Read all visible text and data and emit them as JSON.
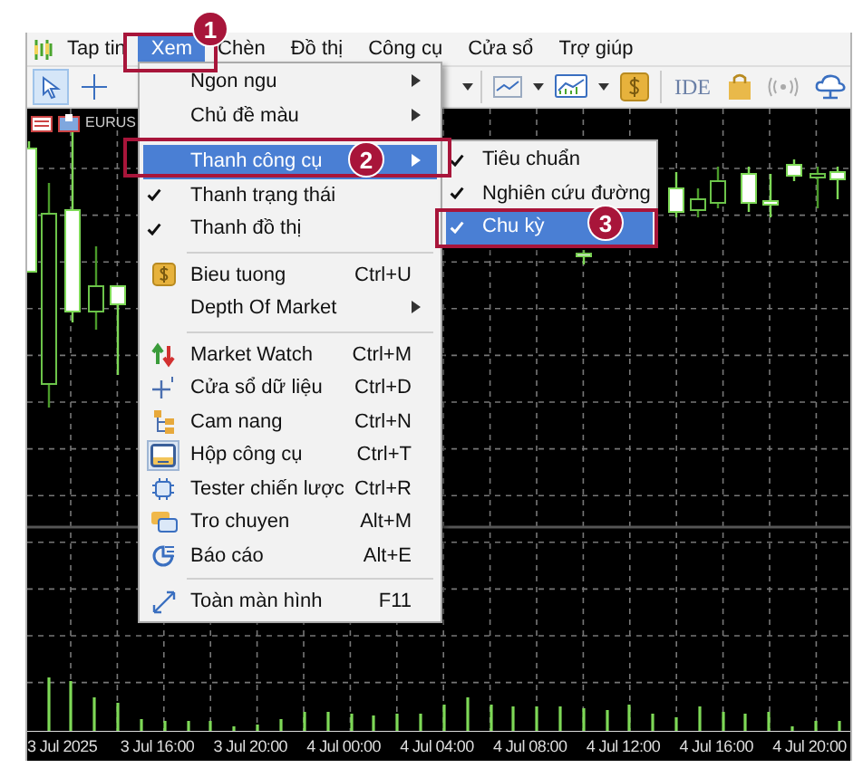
{
  "menubar": [
    {
      "label": "Tap tin",
      "selected": false
    },
    {
      "label": "Xem",
      "selected": true
    },
    {
      "label": "Chèn",
      "selected": false
    },
    {
      "label": "Đồ thị",
      "selected": false
    },
    {
      "label": "Công cụ",
      "selected": false
    },
    {
      "label": "Cửa sổ",
      "selected": false
    },
    {
      "label": "Trợ giúp",
      "selected": false
    }
  ],
  "toolbar": {
    "tools": [
      {
        "selected": true
      },
      {
        "selected": false
      }
    ],
    "ide_label": "IDE"
  },
  "chart": {
    "symbol": "EURUS",
    "time_labels": [
      "3 Jul 2025",
      "3 Jul 16:00",
      "3 Jul 20:00",
      "4 Jul 00:00",
      "4 Jul 04:00",
      "4 Jul 08:00",
      "4 Jul 12:00",
      "4 Jul 16:00",
      "4 Jul 20:00"
    ]
  },
  "view_menu": [
    {
      "kind": "submenu",
      "label": "Ngon ngu",
      "selected": false
    },
    {
      "kind": "submenu",
      "label": "Chủ đề màu",
      "selected": false
    },
    {
      "kind": "submenu",
      "label": "Thanh công cụ",
      "selected": true,
      "divider_above": true
    },
    {
      "kind": "check",
      "label": "Thanh trạng thái",
      "selected": false,
      "checked": true
    },
    {
      "kind": "check",
      "label": "Thanh đồ thị",
      "selected": false,
      "checked": true
    },
    {
      "kind": "command",
      "label": "Bieu tuong",
      "shortcut": "Ctrl+U",
      "selected": false,
      "checked": false,
      "divider_above": true
    },
    {
      "kind": "submenu",
      "label": "Depth Of Market",
      "selected": false
    },
    {
      "kind": "command",
      "label": "Market Watch",
      "shortcut": "Ctrl+M",
      "selected": false,
      "checked": false,
      "divider_above": true
    },
    {
      "kind": "command",
      "label": "Cửa sổ dữ liệu",
      "shortcut": "Ctrl+D",
      "selected": false,
      "checked": false
    },
    {
      "kind": "command",
      "label": "Cam nang",
      "shortcut": "Ctrl+N",
      "selected": false,
      "checked": false
    },
    {
      "kind": "command",
      "label": "Hộp công cụ",
      "shortcut": "Ctrl+T",
      "selected": false,
      "checked": true
    },
    {
      "kind": "command",
      "label": "Tester chiến lược",
      "shortcut": "Ctrl+R",
      "selected": false,
      "checked": false
    },
    {
      "kind": "command",
      "label": "Tro chuyen",
      "shortcut": "Alt+M",
      "selected": false,
      "checked": false
    },
    {
      "kind": "command",
      "label": "Báo cáo",
      "shortcut": "Alt+E",
      "selected": false,
      "checked": false
    },
    {
      "kind": "command",
      "label": "Toàn màn hình",
      "shortcut": "F11",
      "selected": false,
      "checked": false,
      "divider_above": true
    }
  ],
  "toolbars_submenu": [
    {
      "label": "Tiêu chuẩn",
      "selected": false,
      "checked": true
    },
    {
      "label": "Nghiên cứu đường",
      "selected": false,
      "checked": true
    },
    {
      "label": "Chu kỳ",
      "selected": true,
      "checked": true
    }
  ],
  "annotations": [
    {
      "label": "1"
    },
    {
      "label": "2"
    },
    {
      "label": "3"
    }
  ]
}
